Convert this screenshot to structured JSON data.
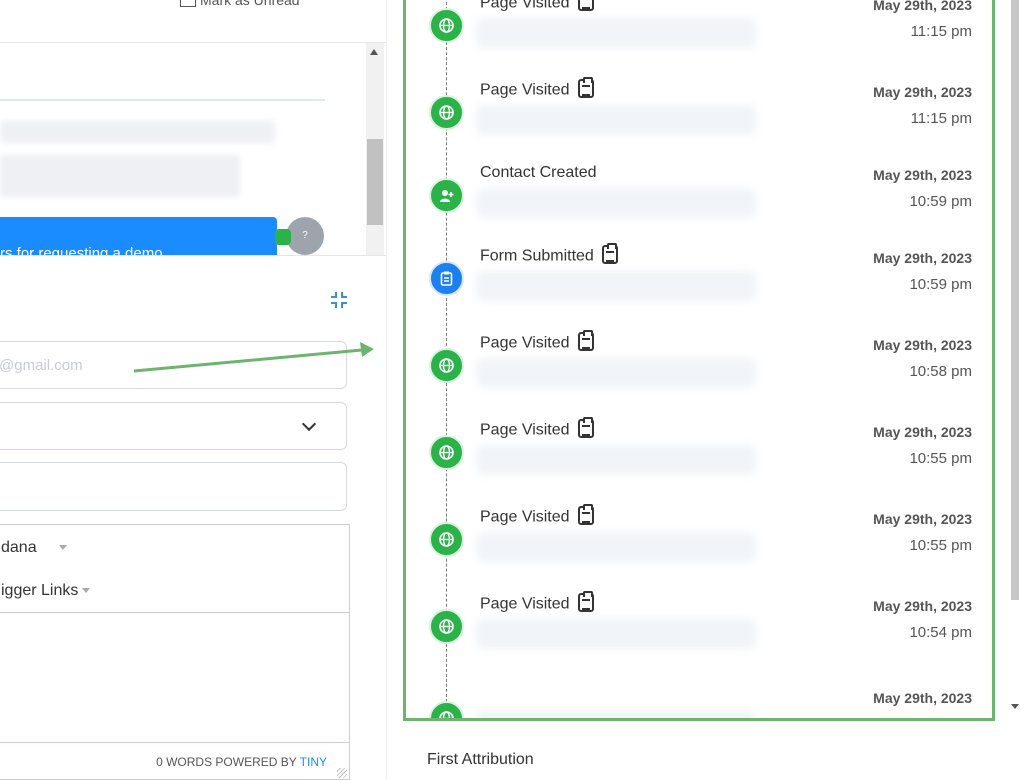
{
  "left": {
    "mark_unread_label": "Mark as Unread",
    "chat_bubble_text": "rs for requesting a demo",
    "avatar_text": "?",
    "email_placeholder": "@gmail.com",
    "editor": {
      "font_dropdown": "dana",
      "trigger_dropdown": "igger Links",
      "word_count_label": "0 WORDS POWERED BY ",
      "tiny_label": "TINY"
    }
  },
  "timeline": {
    "events": [
      {
        "title": "Page Visited",
        "has_clipboard": true,
        "icon": "globe-icon",
        "date": "May 29th, 2023",
        "time": "11:15 pm"
      },
      {
        "title": "Page Visited",
        "has_clipboard": true,
        "icon": "globe-icon",
        "date": "May 29th, 2023",
        "time": "11:15 pm"
      },
      {
        "title": "Contact Created",
        "has_clipboard": false,
        "icon": "add-user-icon",
        "date": "May 29th, 2023",
        "time": "10:59 pm"
      },
      {
        "title": "Form Submitted",
        "has_clipboard": true,
        "icon": "clipboard-icon",
        "date": "May 29th, 2023",
        "time": "10:59 pm"
      },
      {
        "title": "Page Visited",
        "has_clipboard": true,
        "icon": "globe-icon",
        "date": "May 29th, 2023",
        "time": "10:58 pm"
      },
      {
        "title": "Page Visited",
        "has_clipboard": true,
        "icon": "globe-icon",
        "date": "May 29th, 2023",
        "time": "10:55 pm"
      },
      {
        "title": "Page Visited",
        "has_clipboard": true,
        "icon": "globe-icon",
        "date": "May 29th, 2023",
        "time": "10:55 pm"
      },
      {
        "title": "Page Visited",
        "has_clipboard": true,
        "icon": "globe-icon",
        "date": "May 29th, 2023",
        "time": "10:54 pm"
      },
      {
        "title": "",
        "has_clipboard": false,
        "icon": "globe-icon",
        "date": "May 29th, 2023",
        "time": ""
      }
    ]
  },
  "right": {
    "first_attribution_label": "First Attribution"
  },
  "colors": {
    "highlight_green": "#6db56f",
    "event_green": "#2bb34a",
    "event_blue": "#1d80f0",
    "chat_blue": "#1a8cff"
  }
}
